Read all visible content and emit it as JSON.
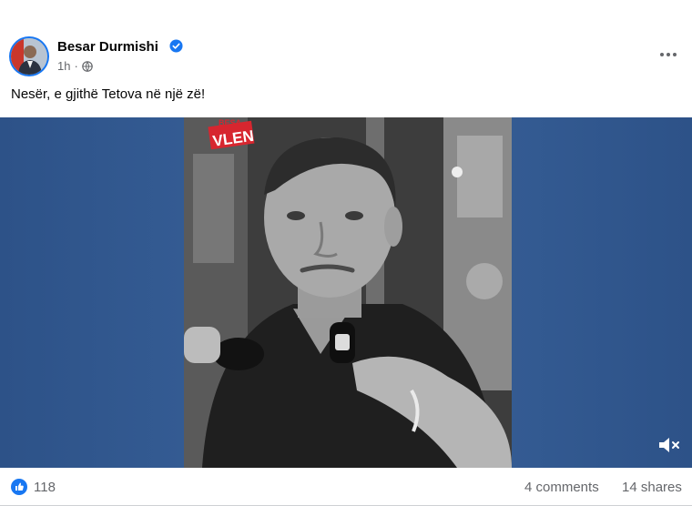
{
  "post": {
    "author": "Besar Durmishi",
    "time": "1h",
    "separator": "·",
    "caption": "Nesër, e gjithë Tetova në një zë!",
    "video_badge": "VLEN",
    "video_badge_top": "BESA"
  },
  "stats": {
    "reactions": "118",
    "comments": "4 comments",
    "shares": "14 shares"
  },
  "icons": {
    "verified": "verified-badge-icon",
    "privacy": "globe-icon",
    "more": "more-options-icon",
    "like": "like-icon",
    "mute": "muted-speaker-icon"
  },
  "colors": {
    "brand_blue": "#1877f2",
    "media_background": "#33598f",
    "badge_red": "#d7262f"
  }
}
